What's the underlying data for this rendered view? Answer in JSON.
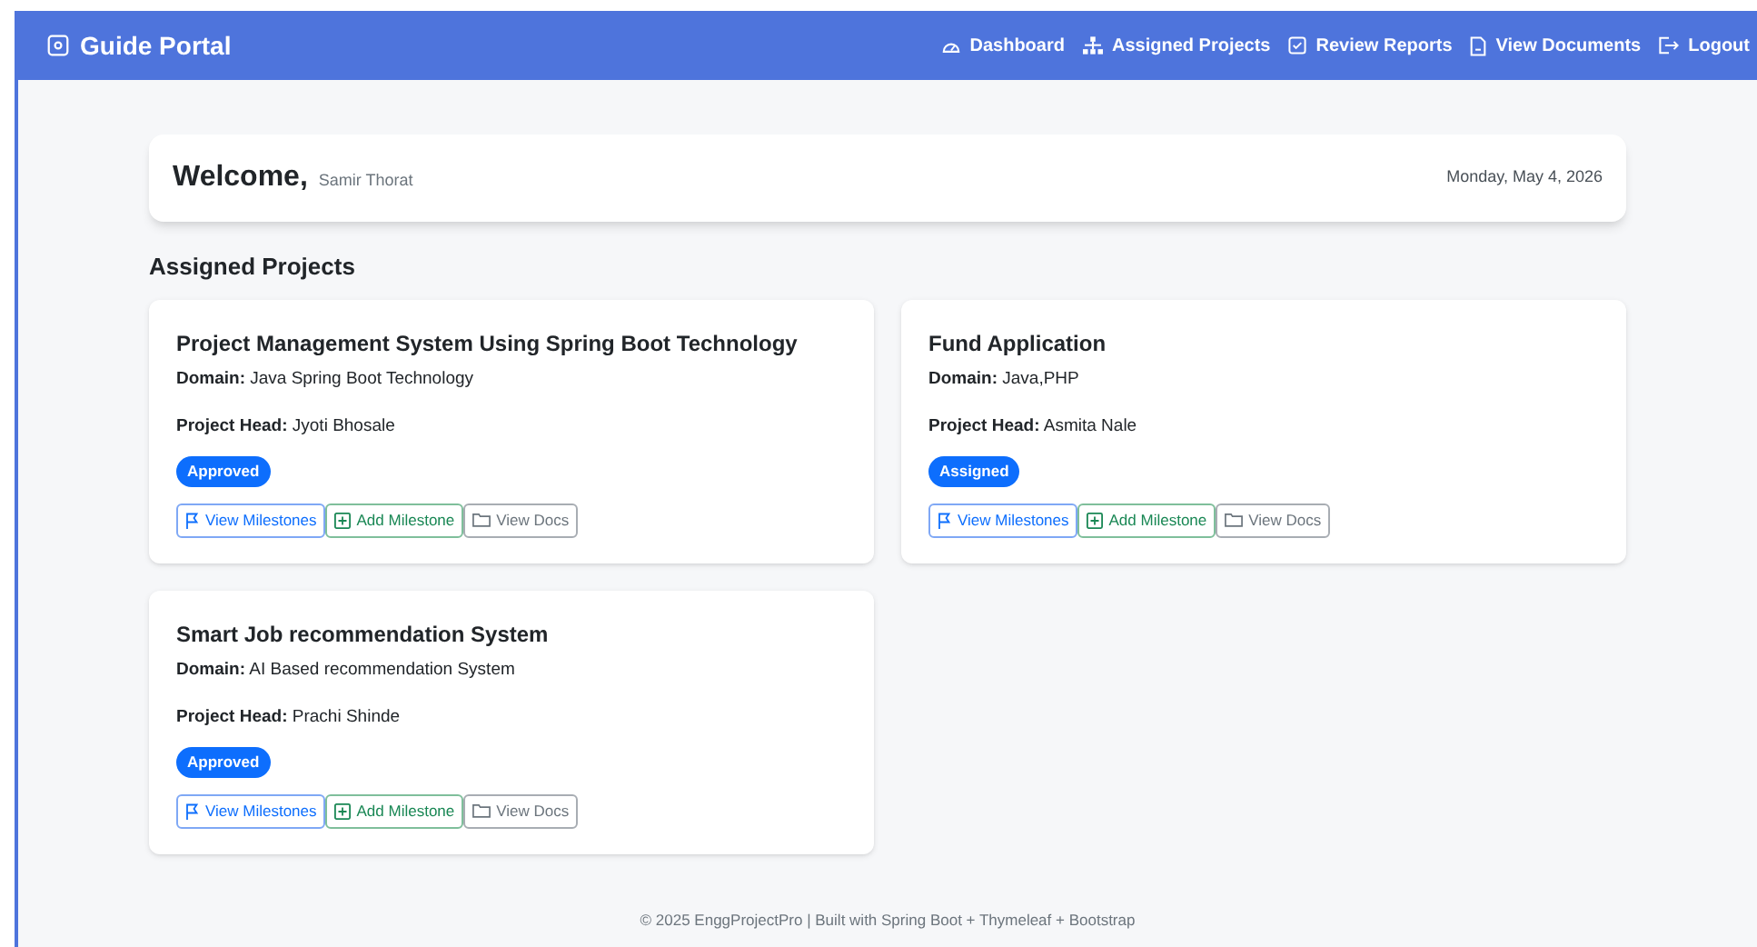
{
  "navbar": {
    "brand": "Guide Portal",
    "links": [
      {
        "kind": "dashboard",
        "label": "Dashboard"
      },
      {
        "kind": "projects",
        "label": "Assigned Projects"
      },
      {
        "kind": "reports",
        "label": "Review Reports"
      },
      {
        "kind": "documents",
        "label": "View Documents"
      },
      {
        "kind": "logout",
        "label": "Logout"
      }
    ]
  },
  "welcome": {
    "greeting": "Welcome,",
    "name": "Samir Thorat",
    "date": "Monday, May 4, 2026"
  },
  "section_title": "Assigned Projects",
  "projects": [
    {
      "title": "Project Management System Using Spring Boot Technology",
      "domain_label": "Domain:",
      "domain": "Java Spring Boot Technology",
      "head_label": "Project Head:",
      "head": "Jyoti Bhosale",
      "status": "Approved",
      "actions": [
        {
          "kind": "milestones",
          "label": "View Milestones"
        },
        {
          "kind": "add",
          "label": "Add Milestone"
        },
        {
          "kind": "docs",
          "label": "View Docs"
        }
      ]
    },
    {
      "title": "Fund Application",
      "domain_label": "Domain:",
      "domain": "Java,PHP",
      "head_label": "Project Head:",
      "head": "Asmita Nale",
      "status": "Assigned",
      "actions": [
        {
          "kind": "milestones",
          "label": "View Milestones"
        },
        {
          "kind": "add",
          "label": "Add Milestone"
        },
        {
          "kind": "docs",
          "label": "View Docs"
        }
      ]
    },
    {
      "title": "Smart Job recommendation System",
      "domain_label": "Domain:",
      "domain": "AI Based recommendation System",
      "head_label": "Project Head:",
      "head": "Prachi Shinde",
      "status": "Approved",
      "actions": [
        {
          "kind": "milestones",
          "label": "View Milestones"
        },
        {
          "kind": "add",
          "label": "Add Milestone"
        },
        {
          "kind": "docs",
          "label": "View Docs"
        }
      ]
    }
  ],
  "footer": "© 2025 EnggProjectPro | Built with Spring Boot + Thymeleaf + Bootstrap"
}
